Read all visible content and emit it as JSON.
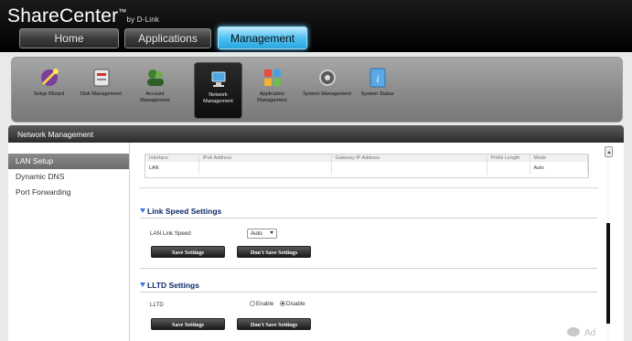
{
  "header": {
    "brand": "ShareCenter",
    "brand_tm": "™",
    "brand_by": "by D-Link",
    "tabs": [
      {
        "label": "Home"
      },
      {
        "label": "Applications"
      },
      {
        "label": "Management"
      }
    ],
    "active_tab": "Management"
  },
  "toolbar": {
    "items": [
      {
        "label": "Setup Wizard",
        "icon": "wand-icon"
      },
      {
        "label": "Disk Management",
        "icon": "disk-icon"
      },
      {
        "label": "Account Management",
        "icon": "users-icon"
      },
      {
        "label": "Network Management",
        "icon": "network-icon"
      },
      {
        "label": "Application Management",
        "icon": "apps-icon"
      },
      {
        "label": "System Management",
        "icon": "gear-icon"
      },
      {
        "label": "System Status",
        "icon": "info-icon"
      }
    ],
    "active": "Network Management"
  },
  "section": {
    "title": "Network Management"
  },
  "sidebar": {
    "items": [
      {
        "label": "LAN Setup"
      },
      {
        "label": "Dynamic DNS"
      },
      {
        "label": "Port Forwarding"
      }
    ],
    "active": "LAN Setup"
  },
  "ipv6_table": {
    "headers": [
      "Interface",
      "IPv6 Address",
      "Gateway IP Address",
      "Prefix Length",
      "Mode"
    ],
    "rows": [
      [
        "LAN",
        "",
        "",
        "",
        "Auto"
      ]
    ]
  },
  "link_speed": {
    "title": "Link Speed Settings",
    "label": "LAN Link Speed",
    "value": "Auto",
    "save_label": "Save Settings",
    "dont_save_label": "Don't Save Settings"
  },
  "lltd": {
    "title": "LLTD Settings",
    "label": "LLTD",
    "options": [
      "Enable",
      "Disable"
    ],
    "selected": "Disable",
    "save_label": "Save Settings",
    "dont_save_label": "Don't Save Settings"
  },
  "watermark": "Ad",
  "colors": {
    "accent": "#4fc0f2",
    "header_bg": "#000000",
    "section_title": "#0c2a6b"
  }
}
